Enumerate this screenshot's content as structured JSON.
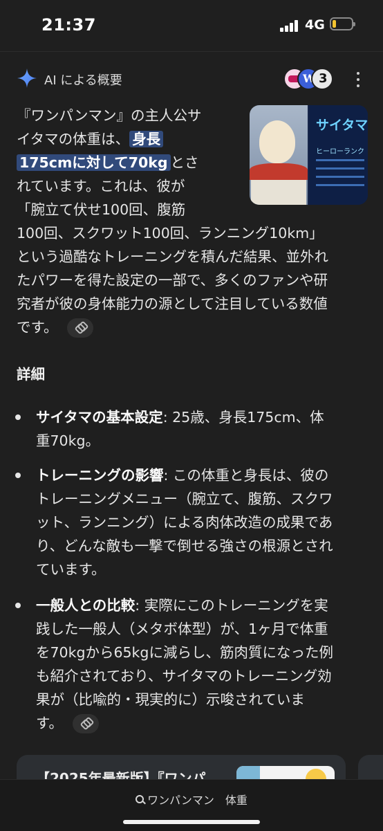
{
  "status_bar": {
    "time": "21:37",
    "network": "4G"
  },
  "ai_overview": {
    "title": "AI による概要",
    "source_icons": [
      "bow-source-icon",
      "wordpress-source-icon",
      "number-3-source-icon"
    ],
    "thumbnail_text": {
      "name": "サイタマ",
      "subtitle": "ヒーローランク"
    },
    "summary": {
      "l1": "『ワンパンマン』の主人公サ",
      "l2_pre": "イタマの体重は、",
      "l2_hl": "身長",
      "l3_hl": "175cmに対して70kg",
      "l3_post": "とさ",
      "l4": "れています。これは、彼が",
      "l5": "「腕立て伏せ100回、腹筋",
      "l6": "100回、スクワット100回、ランニング10km」",
      "l7": "という過酷なトレーニングを積んだ結果、並外れ",
      "l8": "たパワーを得た設定の一部で、多くのファンや研",
      "l9": "究者が彼の身体能力の源として注目している数値",
      "l10": "です。"
    },
    "details_heading": "詳細",
    "bullets": [
      {
        "label": "サイタマの基本設定",
        "lines": [
          ": 25歳、身長175cm、体",
          "重70kg。"
        ]
      },
      {
        "label": "トレーニングの影響",
        "lines": [
          ": この体重と身長は、彼の",
          "トレーニングメニュー（腕立て、腹筋、スクワ",
          "ット、ランニング）による肉体改造の成果であ",
          "り、どんな敵も一撃で倒せる強さの根源とされ",
          "ています。"
        ]
      },
      {
        "label": "一般人との比較",
        "lines": [
          ": 実際にこのトレーニングを実",
          "践した一般人（メタボ体型）が、1ヶ月で体重",
          "を70kgから65kgに減らし、筋肉質になった例",
          "も紹介されており、サイタマのトレーニング効",
          "果が（比喩的・現実的に）示唆されていま",
          "す。"
        ]
      }
    ]
  },
  "result_card": {
    "title": "【2025年最新版】『ワンパ"
  },
  "bottom_search": {
    "query": "ワンパンマン　体重"
  }
}
